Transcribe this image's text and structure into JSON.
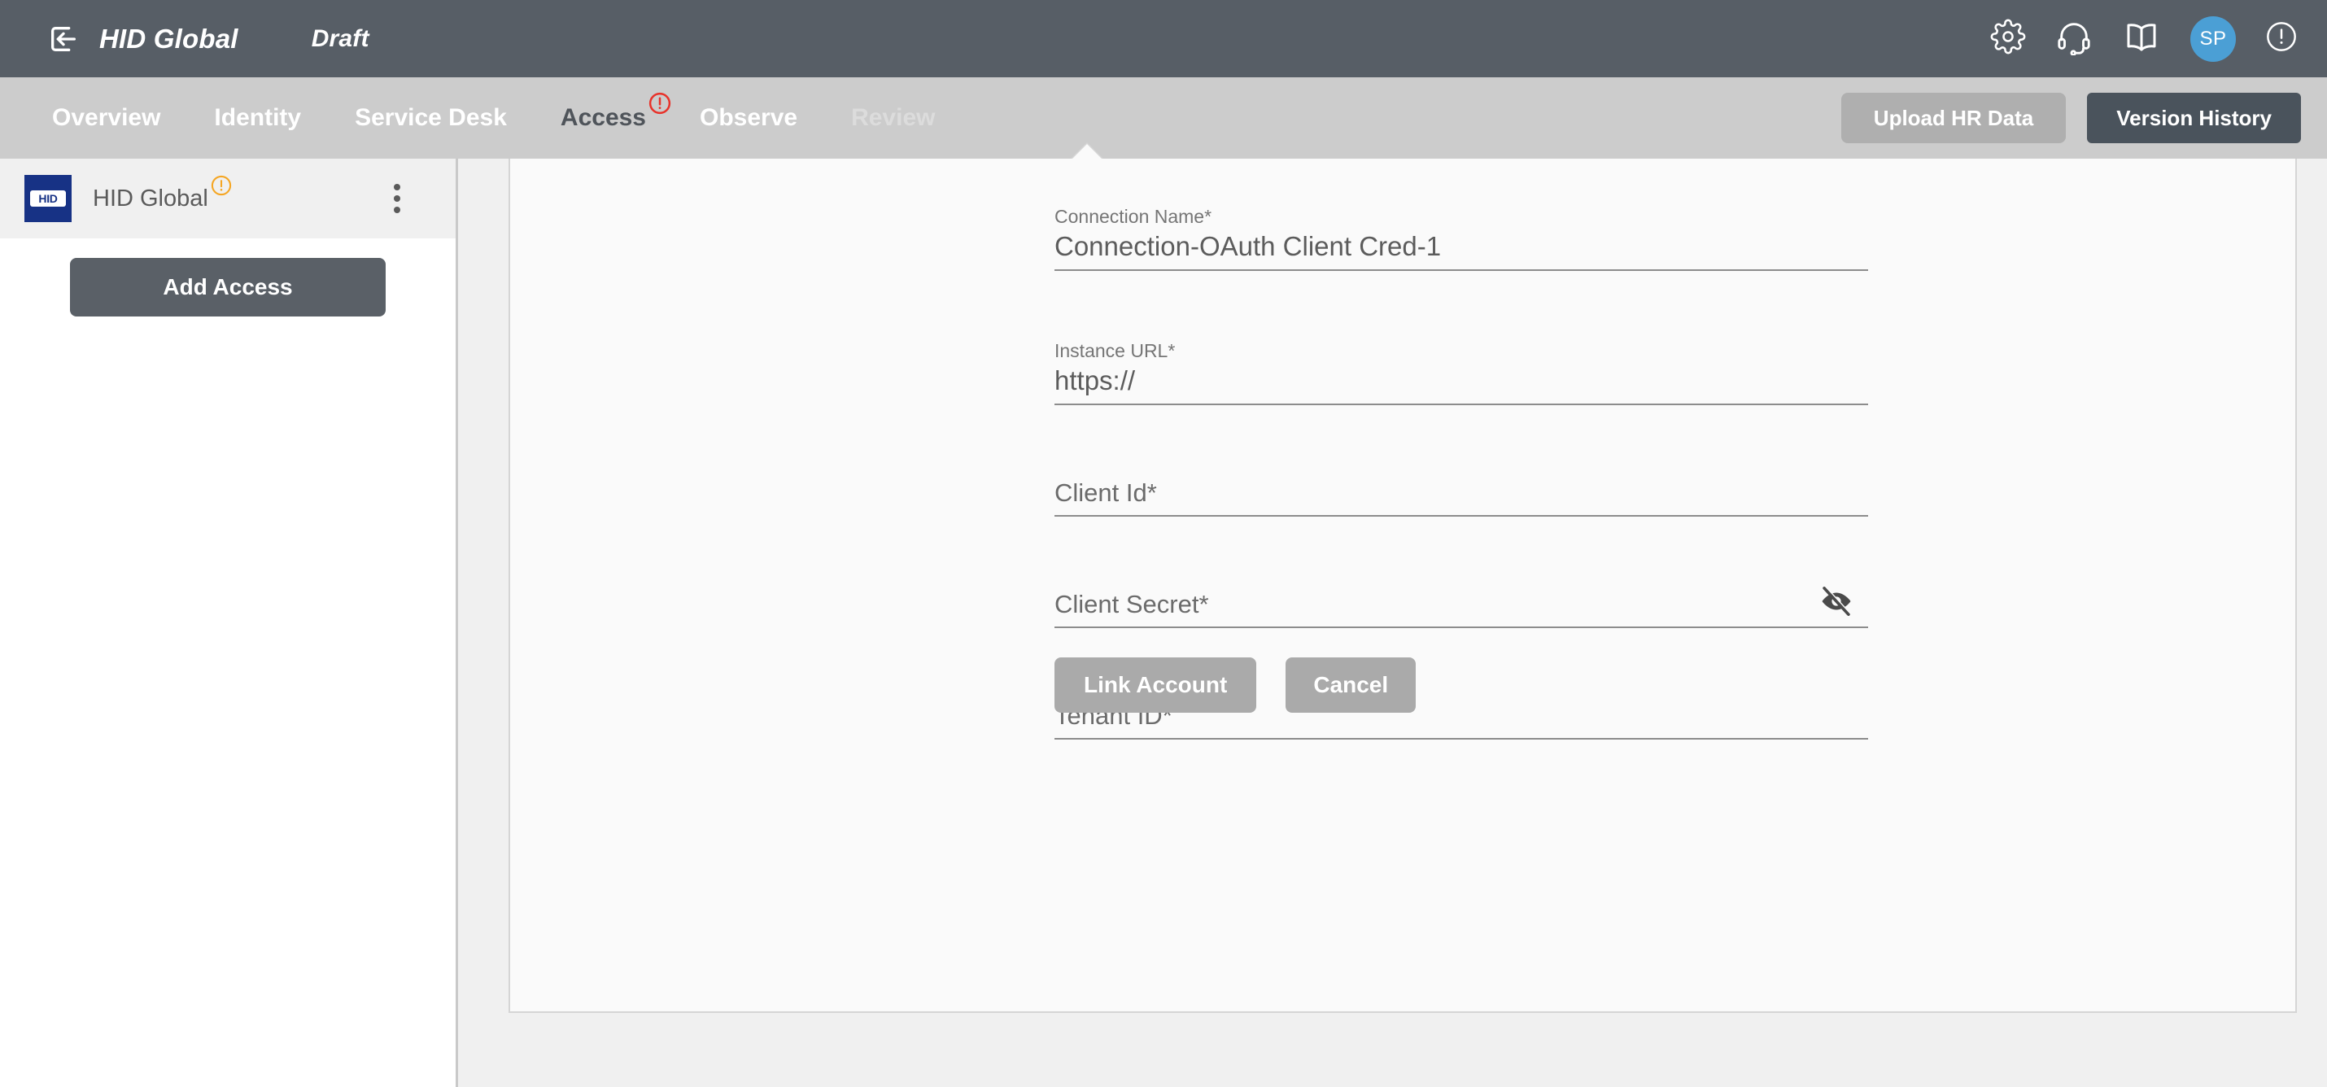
{
  "header": {
    "exit_icon": "exit-arrow-icon",
    "title": "HID Global",
    "status": "Draft",
    "icons": [
      "gear-icon",
      "headset-icon",
      "book-icon"
    ],
    "avatar_initials": "SP",
    "alert_icon": "exclamation-circle-icon",
    "bg_color": "#575e66"
  },
  "nav": {
    "tabs": [
      {
        "label": "Overview",
        "state": "enabled"
      },
      {
        "label": "Identity",
        "state": "enabled"
      },
      {
        "label": "Service Desk",
        "state": "enabled"
      },
      {
        "label": "Access",
        "state": "active",
        "badge": "exclamation-circle-icon"
      },
      {
        "label": "Observe",
        "state": "enabled"
      },
      {
        "label": "Review",
        "state": "disabled"
      }
    ],
    "upload_label": "Upload HR Data",
    "version_label": "Version History",
    "bg_color": "#cccccc",
    "active_color": "#4f545a",
    "badge_color": "#e8322a"
  },
  "sidebar": {
    "connection": {
      "logo_text": "HID",
      "name": "HID Global",
      "badge": "warning-exclamation-icon",
      "badge_color": "#f5a623",
      "menu_icon": "kebab-menu-icon"
    },
    "add_access_label": "Add Access"
  },
  "form": {
    "fields": [
      {
        "label": "Connection Name*",
        "value": "Connection-OAuth Client Cred-1",
        "placeholder": "Connection Name*",
        "filled": true
      },
      {
        "label": "Instance URL*",
        "value": "https://",
        "placeholder": "Instance URL*",
        "filled": true
      },
      {
        "label": "Client Id*",
        "value": "",
        "placeholder": "Client Id*",
        "filled": false
      },
      {
        "label": "Client Secret*",
        "value": "",
        "placeholder": "Client Secret*",
        "filled": false,
        "toggle_icon": "eye-off-icon"
      },
      {
        "label": "Tenant ID*",
        "value": "",
        "placeholder": "Tenant ID*",
        "filled": false
      }
    ],
    "link_account_label": "Link Account",
    "cancel_label": "Cancel"
  }
}
